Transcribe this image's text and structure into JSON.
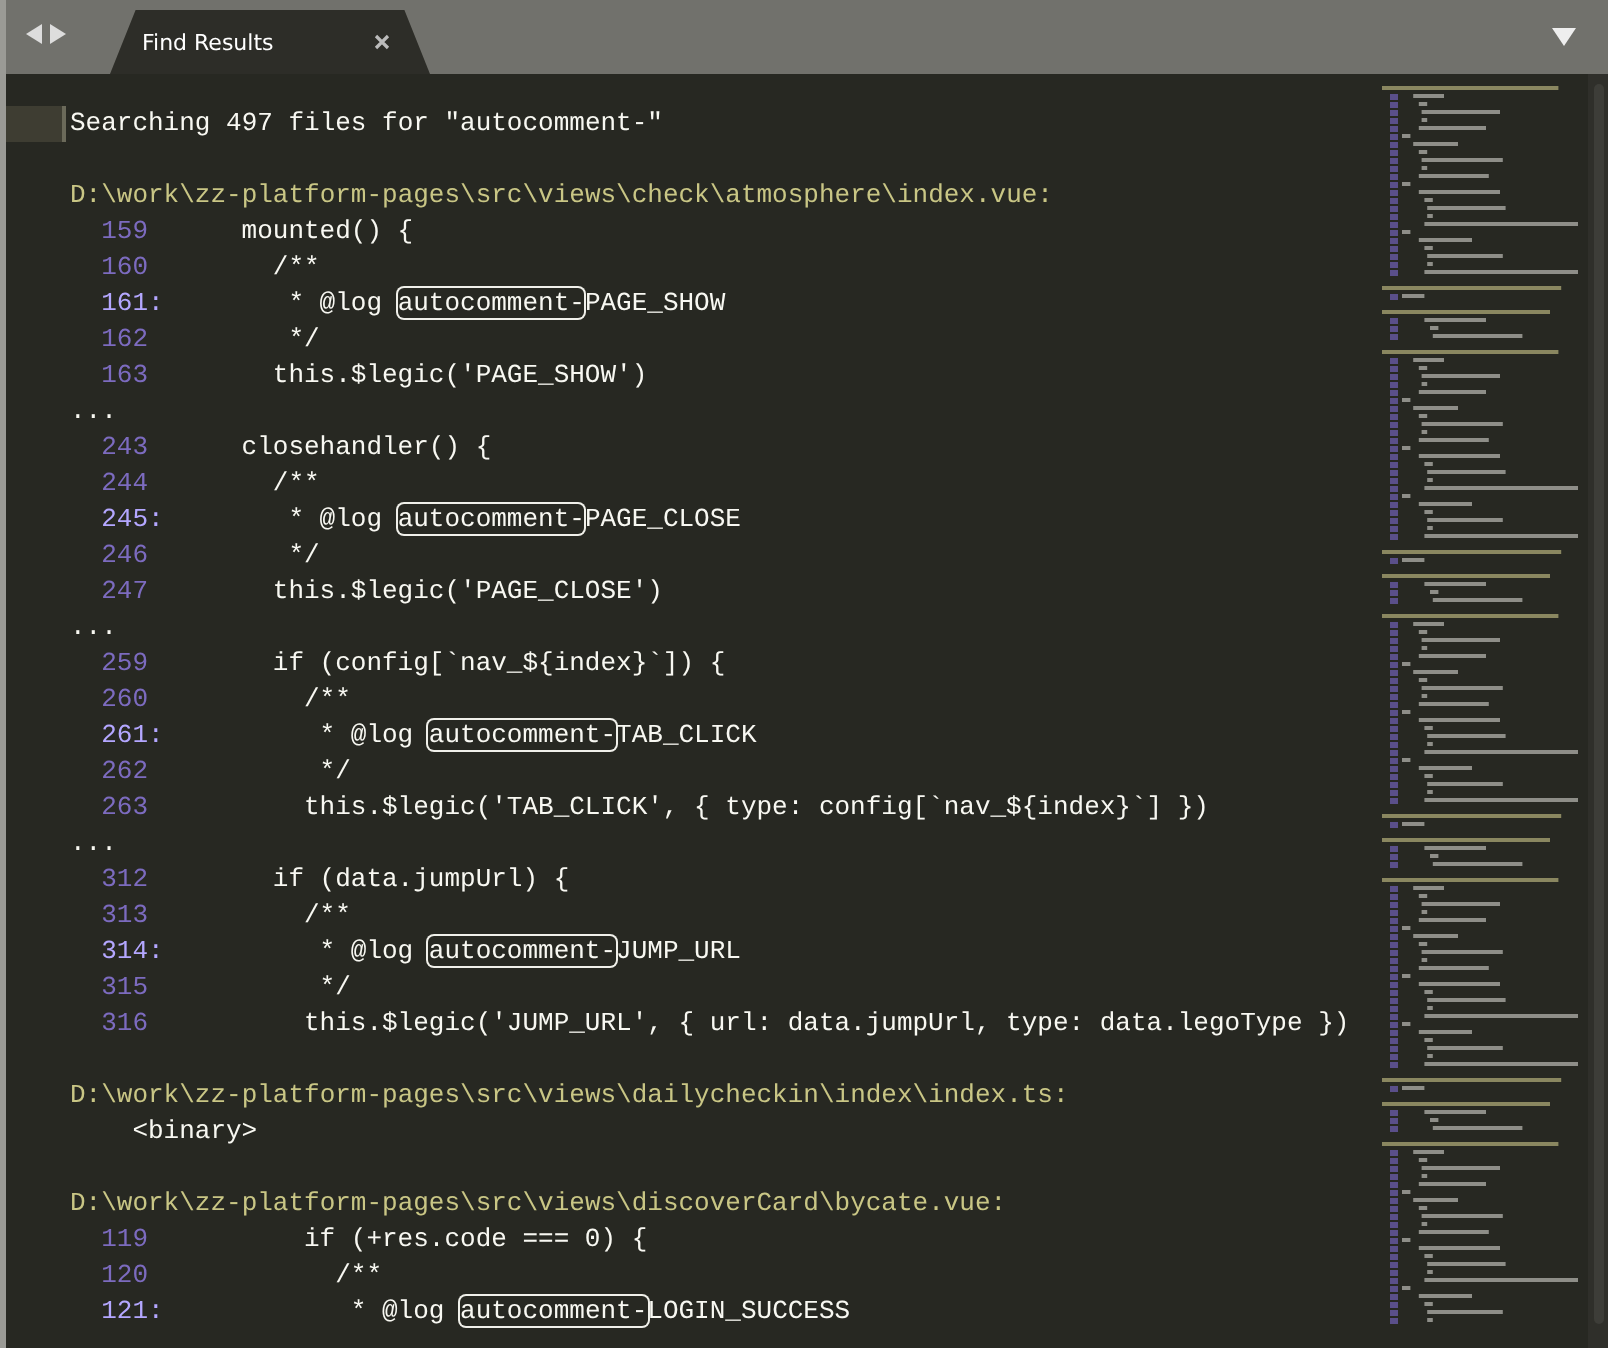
{
  "tab": {
    "title": "Find Results",
    "selected": true
  },
  "summary": "Searching 497 files for \"autocomment-\"",
  "files": [
    {
      "path": "D:\\work\\zz-platform-pages\\src\\views\\check\\atmosphere\\index.vue:",
      "lines": [
        {
          "kind": "line",
          "number": "159",
          "match": false,
          "code": "    mounted() {"
        },
        {
          "kind": "line",
          "number": "160",
          "match": false,
          "code": "      /**"
        },
        {
          "kind": "line",
          "number": "161:",
          "match": true,
          "code": "       * @log ",
          "hit": "autocomment-",
          "rest": "PAGE_SHOW"
        },
        {
          "kind": "line",
          "number": "162",
          "match": false,
          "code": "       */"
        },
        {
          "kind": "line",
          "number": "163",
          "match": false,
          "code": "      this.$legic('PAGE_SHOW')"
        },
        {
          "kind": "gap",
          "text": "..."
        },
        {
          "kind": "line",
          "number": "243",
          "match": false,
          "code": "    closehandler() {"
        },
        {
          "kind": "line",
          "number": "244",
          "match": false,
          "code": "      /**"
        },
        {
          "kind": "line",
          "number": "245:",
          "match": true,
          "code": "       * @log ",
          "hit": "autocomment-",
          "rest": "PAGE_CLOSE"
        },
        {
          "kind": "line",
          "number": "246",
          "match": false,
          "code": "       */"
        },
        {
          "kind": "line",
          "number": "247",
          "match": false,
          "code": "      this.$legic('PAGE_CLOSE')"
        },
        {
          "kind": "gap",
          "text": "..."
        },
        {
          "kind": "line",
          "number": "259",
          "match": false,
          "code": "      if (config[`nav_${index}`]) {"
        },
        {
          "kind": "line",
          "number": "260",
          "match": false,
          "code": "        /**"
        },
        {
          "kind": "line",
          "number": "261:",
          "match": true,
          "code": "         * @log ",
          "hit": "autocomment-",
          "rest": "TAB_CLICK"
        },
        {
          "kind": "line",
          "number": "262",
          "match": false,
          "code": "         */"
        },
        {
          "kind": "line",
          "number": "263",
          "match": false,
          "code": "        this.$legic('TAB_CLICK', { type: config[`nav_${index}`] })"
        },
        {
          "kind": "gap",
          "text": "..."
        },
        {
          "kind": "line",
          "number": "312",
          "match": false,
          "code": "      if (data.jumpUrl) {"
        },
        {
          "kind": "line",
          "number": "313",
          "match": false,
          "code": "        /**"
        },
        {
          "kind": "line",
          "number": "314:",
          "match": true,
          "code": "         * @log ",
          "hit": "autocomment-",
          "rest": "JUMP_URL"
        },
        {
          "kind": "line",
          "number": "315",
          "match": false,
          "code": "         */"
        },
        {
          "kind": "line",
          "number": "316",
          "match": false,
          "code": "        this.$legic('JUMP_URL', { url: data.jumpUrl, type: data.legoType })"
        }
      ]
    },
    {
      "path": "D:\\work\\zz-platform-pages\\src\\views\\dailycheckin\\index\\index.ts:",
      "lines": [
        {
          "kind": "note",
          "text": "<binary>"
        }
      ]
    },
    {
      "path": "D:\\work\\zz-platform-pages\\src\\views\\discoverCard\\bycate.vue:",
      "lines": [
        {
          "kind": "line",
          "number": "119",
          "match": false,
          "code": "        if (+res.code === 0) {"
        },
        {
          "kind": "line",
          "number": "120",
          "match": false,
          "code": "          /**"
        },
        {
          "kind": "line",
          "number": "121:",
          "match": true,
          "code": "           * @log ",
          "hit": "autocomment-",
          "rest": "LOGIN_SUCCESS"
        }
      ]
    }
  ]
}
